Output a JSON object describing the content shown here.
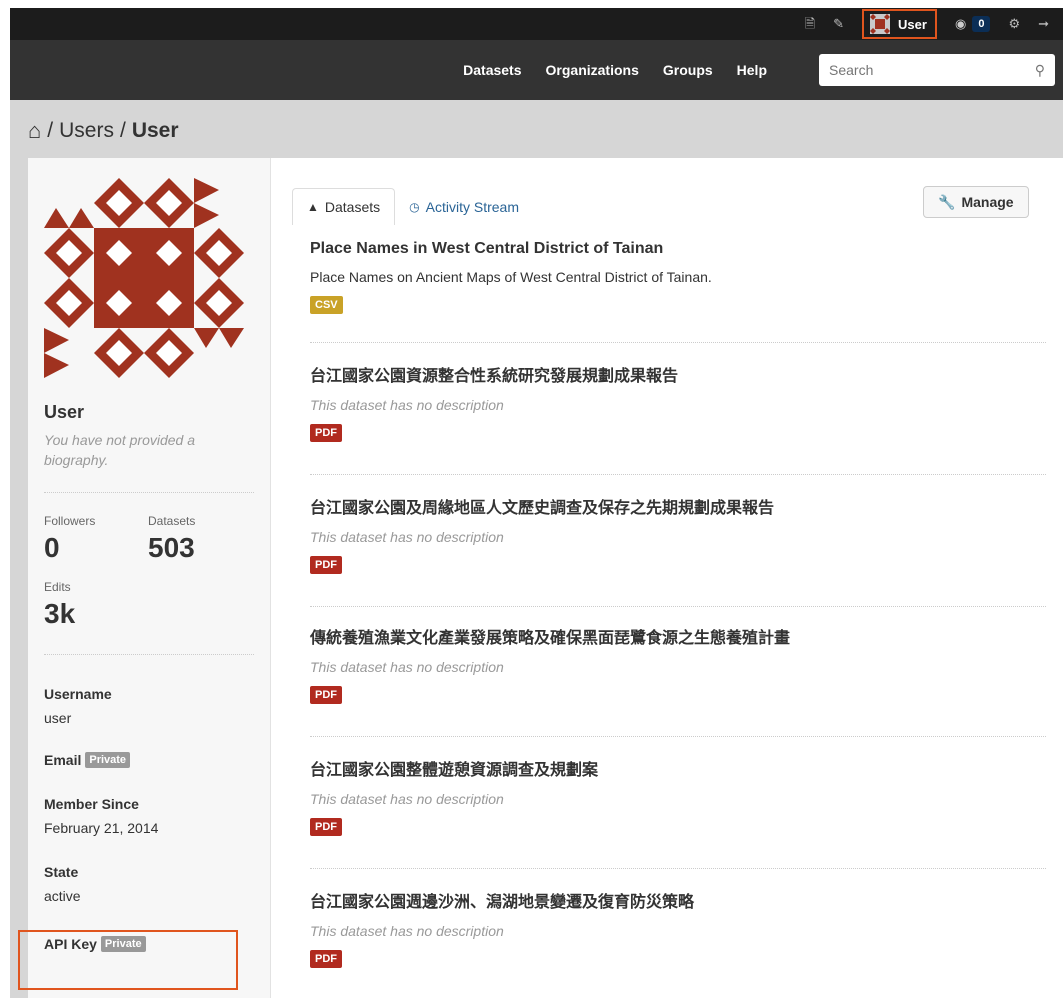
{
  "account_bar": {
    "user_label": "User",
    "dashboard_count": "0",
    "icons": [
      "file-icon",
      "pencil-icon",
      "dashboard-icon",
      "gear-icon",
      "sign-out-icon"
    ]
  },
  "nav": {
    "links": [
      "Datasets",
      "Organizations",
      "Groups",
      "Help"
    ],
    "search_placeholder": "Search"
  },
  "breadcrumb": {
    "sep1": "/",
    "users": "Users",
    "sep2": "/",
    "current": "User"
  },
  "profile": {
    "name": "User",
    "bio": "You have not provided a biography.",
    "followers_label": "Followers",
    "followers": "0",
    "datasets_label": "Datasets",
    "datasets": "503",
    "edits_label": "Edits",
    "edits": "3k",
    "username_label": "Username",
    "username": "user",
    "email_label": "Email",
    "private_badge": "Private",
    "member_since_label": "Member Since",
    "member_since": "February 21, 2014",
    "state_label": "State",
    "state": "active",
    "api_key_label": "API Key"
  },
  "tabs": {
    "datasets": "Datasets",
    "activity": "Activity Stream"
  },
  "manage_label": "Manage",
  "datasets": [
    {
      "title": "Place Names in West Central District of Tainan",
      "description": "Place Names on Ancient Maps of West Central District of Tainan.",
      "format": "CSV"
    },
    {
      "title": "台江國家公園資源整合性系統研究發展規劃成果報告",
      "description": "This dataset has no description",
      "format": "PDF"
    },
    {
      "title": "台江國家公園及周緣地區人文歷史調查及保存之先期規劃成果報告",
      "description": "This dataset has no description",
      "format": "PDF"
    },
    {
      "title": "傳統養殖漁業文化產業發展策略及確保黑面琵鷺食源之生態養殖計畫",
      "description": "This dataset has no description",
      "format": "PDF"
    },
    {
      "title": "台江國家公園整體遊憩資源調查及規劃案",
      "description": "This dataset has no description",
      "format": "PDF"
    },
    {
      "title": "台江國家公園週邊沙洲、潟湖地景變遷及復育防災策略",
      "description": "This dataset has no description",
      "format": "PDF"
    }
  ],
  "colors": {
    "avatar": "#a0321f",
    "csv": "#c9a227",
    "pdf": "#b12a1f",
    "highlight": "#e0551e"
  }
}
